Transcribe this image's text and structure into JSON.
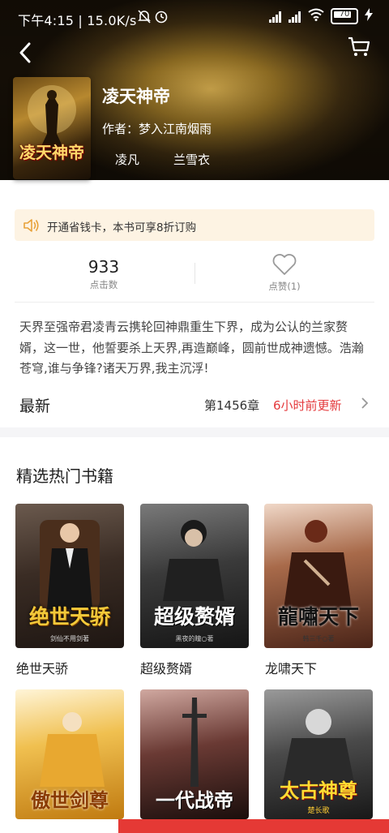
{
  "status_bar": {
    "time": "下午4:15 | 15.0K/s",
    "battery": "70"
  },
  "book": {
    "title": "凌天神帝",
    "author": "作者：梦入江南烟雨",
    "characters": [
      "凌凡",
      "兰雪衣"
    ],
    "cover_text": "凌天神帝"
  },
  "promo": {
    "text": "开通省钱卡，本书可享8折订购"
  },
  "stats": {
    "clicks": "933",
    "clicks_label": "点击数",
    "likes_label": "点赞(1)"
  },
  "description": "天界至强帝君凌青云携轮回神鼎重生下界，成为公认的兰家赘婿，这一世，他誓要杀上天界,再造巅峰，圆前世成神遗憾。浩瀚苍穹,谁与争锋?诸天万界,我主沉浮!",
  "latest": {
    "label": "最新",
    "chapter": "第1456章",
    "updated": "6小时前更新"
  },
  "hot_section": {
    "title": "精选热门书籍",
    "books": [
      {
        "name": "绝世天骄",
        "cover_text": "绝世天骄",
        "sub": "剑仙不用剑著"
      },
      {
        "name": "超级赘婿",
        "cover_text": "超级赘婿",
        "sub": "黑夜的瞳○著"
      },
      {
        "name": "龙啸天下",
        "cover_text": "龍嘯天下",
        "sub": "韩三千○著"
      }
    ],
    "books_row2": [
      {
        "cover_text": "傲世剑尊"
      },
      {
        "cover_text": "一代战帝"
      },
      {
        "cover_text": "太古神尊",
        "sub": "楚长歌"
      }
    ]
  },
  "colors": {
    "accent_red": "#e4393c",
    "promo_bg": "#fdf3e3",
    "hero_gold": "#c8a24a"
  }
}
